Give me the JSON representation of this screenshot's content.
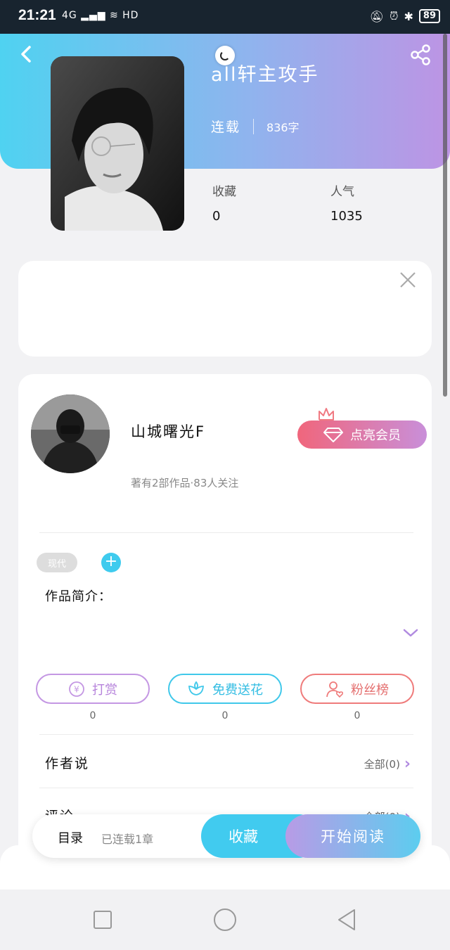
{
  "status_bar": {
    "time": "21:21",
    "network": "4G",
    "hd": "HD",
    "battery": "89"
  },
  "book": {
    "title": "all轩主攻手",
    "status": "连载",
    "word_count": "836字",
    "stats": [
      {
        "label": "收藏",
        "value": "0"
      },
      {
        "label": "人气",
        "value": "1035"
      }
    ]
  },
  "author": {
    "name": "山城曙光F",
    "meta": "著有2部作品·83人关注",
    "vip_label": "点亮会员"
  },
  "tags": {
    "tag": "现代",
    "add": "+"
  },
  "intro": {
    "label": "作品简介："
  },
  "actions": [
    {
      "label": "打赏",
      "count": "0",
      "icon": "yen-coin-icon"
    },
    {
      "label": "免费送花",
      "count": "0",
      "icon": "flower-icon"
    },
    {
      "label": "粉丝榜",
      "count": "0",
      "icon": "user-heart-icon"
    }
  ],
  "rows": {
    "author_says": {
      "label": "作者说",
      "right": "全部(0)"
    },
    "comments": {
      "label": "评论",
      "right": "全部(0)"
    }
  },
  "bottom_bar": {
    "toc": "目录",
    "toc_sub": "已连载1章",
    "favorite": "收藏",
    "start_reading": "开始阅读"
  },
  "colors": {
    "accent_cyan": "#41cbef",
    "accent_purple": "#b89be6",
    "vip_pink": "#f0667c"
  }
}
